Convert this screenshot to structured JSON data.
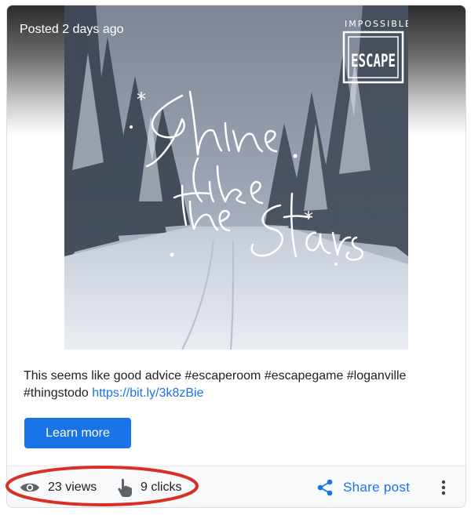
{
  "post": {
    "posted_label": "Posted 2 days ago",
    "image_brand_top": "IMPOSSIBLE",
    "image_brand_logo": "ESCAPE",
    "image_text": "Shine like the Stars",
    "caption_text": "This seems like good advice #escaperoom #escapegame #loganville #thingstodo",
    "caption_link": "https://bit.ly/3k8zBie",
    "cta_label": "Learn more"
  },
  "stats": {
    "views_label": "23 views",
    "clicks_label": "9 clicks"
  },
  "actions": {
    "share_label": "Share post",
    "share_icon": "share-icon",
    "more_icon": "more-vert-icon"
  },
  "colors": {
    "accent": "#1a73e8",
    "annotation": "#d93025",
    "footer_bg": "#f8f9fa"
  }
}
